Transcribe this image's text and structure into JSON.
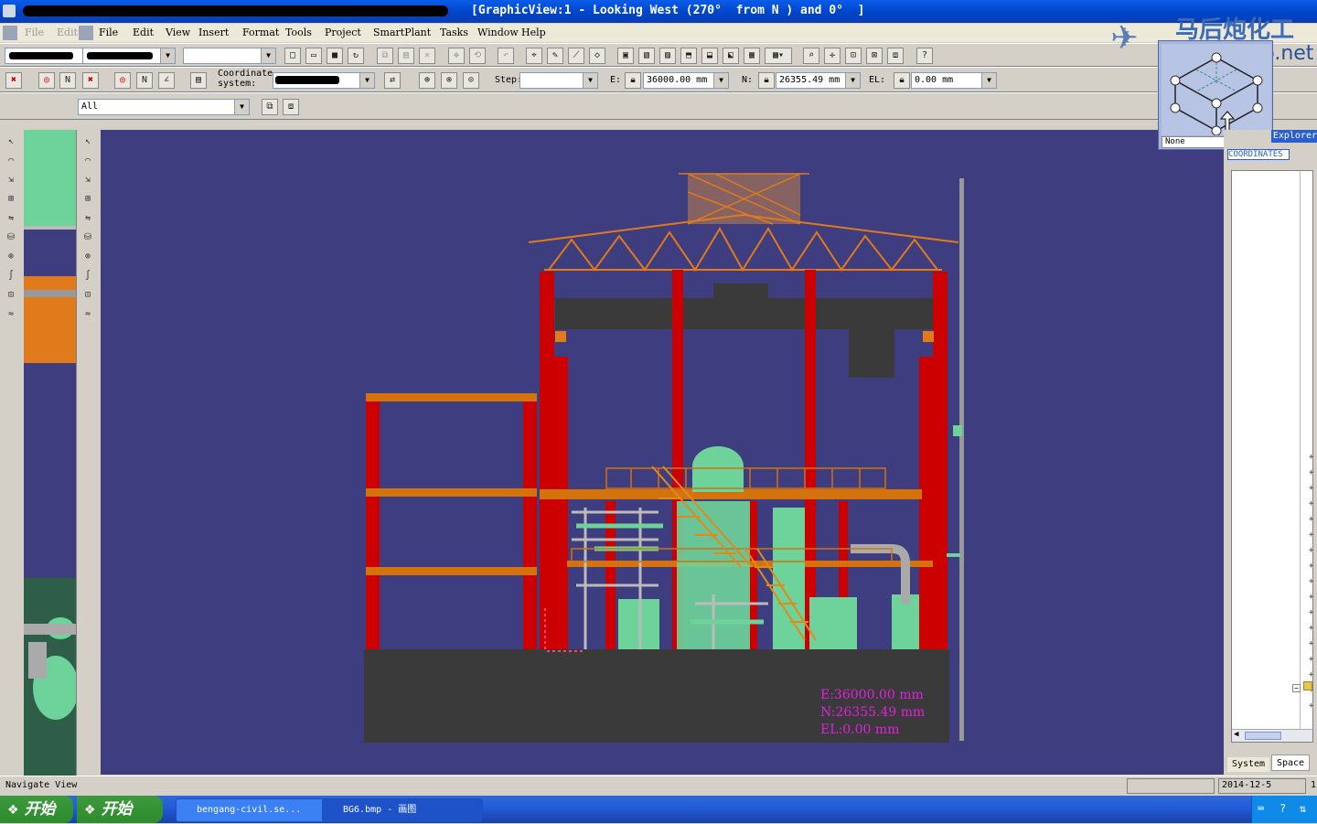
{
  "window": {
    "title": "[GraphicView:1 - Looking West (270°  from N ) and 0°  ]"
  },
  "menu": {
    "ghost_items": [
      "File",
      "Edit"
    ],
    "items": [
      "File",
      "Edit",
      "View",
      "Insert",
      "Format",
      "Tools",
      "Project",
      "SmartPlant",
      "Tasks",
      "Window",
      "Help"
    ]
  },
  "toolbar": {
    "coordinate_label": "Coordinate\nsystem:",
    "step_label": "Step:",
    "e_label": "E:",
    "e_value": "36000.00 mm",
    "n_label": "N:",
    "n_value": "26355.49 mm",
    "el_label": "EL:",
    "el_value": "0.00 mm",
    "filter_value": "All",
    "help_icon": "?"
  },
  "view": {
    "coord_e": "E:36000.00 mm",
    "coord_n": "N:26355.49 mm",
    "coord_el": "EL:0.00 mm",
    "colors": {
      "background": "#3d3d80",
      "steel": "#cc0000",
      "beam": "#d4720c",
      "equipment": "#6ed39a",
      "concrete": "#3a3a3a",
      "roof": "#e07a1a",
      "coords": "#e020e0"
    }
  },
  "orientation_widget": {
    "view_label": "None"
  },
  "watermark": {
    "text_cn": "马后炮化工",
    "text_en": "Mahoupao.net"
  },
  "right_panel": {
    "header": "Space Explorer",
    "tab_label": "COORDINATES",
    "tabs": [
      "System",
      "Space"
    ]
  },
  "status": {
    "left": "Navigate View",
    "date": "2014-12-5",
    "right_digit": "1"
  },
  "taskbar": {
    "start_label": "开始",
    "tasks": [
      "bengang-civil.se...",
      "BG6.bmp - 画图"
    ]
  }
}
